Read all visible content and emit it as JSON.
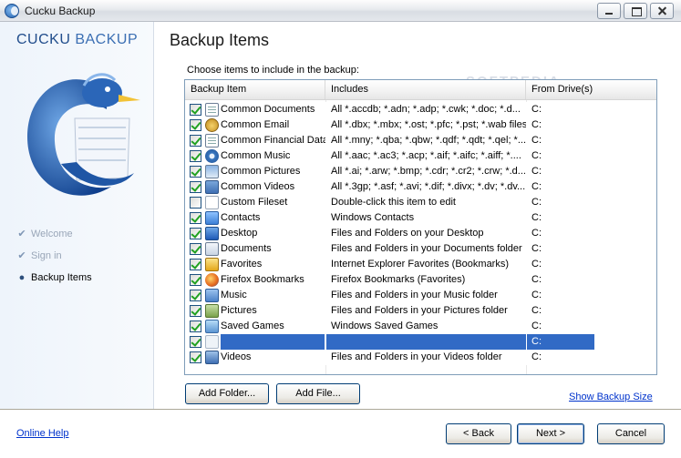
{
  "window": {
    "title": "Cucku Backup"
  },
  "brand": {
    "name_bold": "CUCKU",
    "name_light": " BACKUP"
  },
  "steps": [
    {
      "label": "Welcome",
      "state": "done"
    },
    {
      "label": "Sign in",
      "state": "done"
    },
    {
      "label": "Backup Items",
      "state": "current"
    }
  ],
  "main": {
    "heading": "Backup Items",
    "instruction": "Choose items to include in the backup:",
    "watermark": "SOFTPEDIA"
  },
  "list": {
    "columns": [
      "Backup Item",
      "Includes",
      "From Drive(s)"
    ],
    "rows": [
      {
        "name": "Common Documents",
        "includes": "All *.accdb; *.adn; *.adp; *.cwk; *.doc; *.d...",
        "drive": "C:",
        "checked": true,
        "icon": "document-icon"
      },
      {
        "name": "Common Email",
        "includes": "All *.dbx; *.mbx; *.ost; *.pfc; *.pst; *.wab files",
        "drive": "C:",
        "checked": true,
        "icon": "email-icon"
      },
      {
        "name": "Common Financial Data",
        "includes": "All *.mny; *.qba; *.qbw; *.qdf; *.qdt; *.qel; *...",
        "drive": "C:",
        "checked": true,
        "icon": "financial-document-icon"
      },
      {
        "name": "Common Music",
        "includes": "All *.aac; *.ac3; *.acp; *.aif; *.aifc; *.aiff; *....",
        "drive": "C:",
        "checked": true,
        "icon": "music-disc-icon"
      },
      {
        "name": "Common Pictures",
        "includes": "All *.ai; *.arw; *.bmp; *.cdr; *.cr2; *.crw; *.d...",
        "drive": "C:",
        "checked": true,
        "icon": "pictures-icon"
      },
      {
        "name": "Common Videos",
        "includes": "All *.3gp; *.asf; *.avi; *.dif; *.divx; *.dv; *.dv...",
        "drive": "C:",
        "checked": true,
        "icon": "videos-icon"
      },
      {
        "name": "Custom Fileset",
        "includes": "Double-click this item to edit",
        "drive": "C:",
        "checked": false,
        "icon": "custom-file-icon"
      },
      {
        "name": "Contacts",
        "includes": "Windows Contacts",
        "drive": "C:",
        "checked": true,
        "icon": "contacts-icon"
      },
      {
        "name": "Desktop",
        "includes": "Files and Folders on your Desktop",
        "drive": "C:",
        "checked": true,
        "icon": "desktop-icon"
      },
      {
        "name": "Documents",
        "includes": "Files and Folders in your Documents folder",
        "drive": "C:",
        "checked": true,
        "icon": "documents-folder-icon"
      },
      {
        "name": "Favorites",
        "includes": "Internet Explorer Favorites (Bookmarks)",
        "drive": "C:",
        "checked": true,
        "icon": "favorites-star-icon"
      },
      {
        "name": "Firefox Bookmarks",
        "includes": "Firefox Bookmarks (Favorites)",
        "drive": "C:",
        "checked": true,
        "icon": "firefox-icon"
      },
      {
        "name": "Music",
        "includes": "Files and Folders in your Music folder",
        "drive": "C:",
        "checked": true,
        "icon": "music-folder-icon"
      },
      {
        "name": "Pictures",
        "includes": "Files and Folders in your Pictures folder",
        "drive": "C:",
        "checked": true,
        "icon": "pictures-folder-icon"
      },
      {
        "name": "Saved Games",
        "includes": "Windows Saved Games",
        "drive": "C:",
        "checked": true,
        "icon": "saved-games-icon"
      },
      {
        "name": "",
        "includes": "",
        "drive": "C:",
        "checked": true,
        "icon": "folder-icon",
        "selected": true
      },
      {
        "name": "Videos",
        "includes": "Files and Folders in your Videos folder",
        "drive": "C:",
        "checked": true,
        "icon": "videos-folder-icon"
      }
    ]
  },
  "buttons": {
    "add_folder": "Add Folder...",
    "add_file": "Add File...",
    "show_size": "Show Backup Size",
    "online_help": "Online Help",
    "back": "< Back",
    "next": "Next >",
    "cancel": "Cancel"
  },
  "colors": {
    "accent": "#316ac5",
    "brand": "#214d8c",
    "link": "#0033cc"
  }
}
